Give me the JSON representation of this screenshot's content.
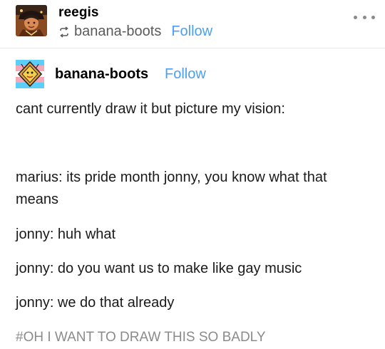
{
  "post": {
    "author": "reegis",
    "reblog": {
      "from_blog": "banana-boots",
      "follow_label": "Follow"
    },
    "more_menu": "more-options"
  },
  "source": {
    "blog_name": "banana-boots",
    "follow_label": "Follow"
  },
  "body": {
    "paragraphs": [
      "cant currently draw it but picture my vision:",
      "marius: its pride month jonny, you know what that means",
      "jonny: huh what",
      "jonny: do you want us to make like gay music",
      "jonny: we do that already"
    ]
  },
  "tags": {
    "text": "#OH I WANT TO DRAW THIS SO BADLY"
  },
  "colors": {
    "follow": "#4a9ff5",
    "muted": "#8b8b8b",
    "text": "#1a1a1a"
  },
  "icons": {
    "reblog": "reblog-icon",
    "more": "more-dots-icon"
  }
}
